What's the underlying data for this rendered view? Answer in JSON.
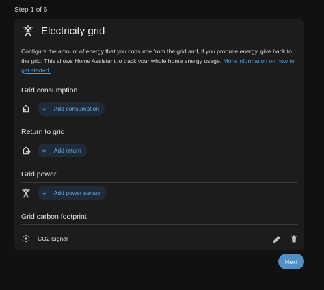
{
  "step_label": "Step 1 of 6",
  "card": {
    "title": "Electricity grid",
    "icon": "transmission-tower-icon",
    "description": "Configure the amount of energy that you consume from the grid and, if you produce energy, give back to the grid. This allows Home Assistant to track your whole home energy usage.",
    "link_text": "More information on how to get started."
  },
  "sections": {
    "consumption": {
      "title": "Grid consumption",
      "button": "Add consumption",
      "icon": "home-import-icon"
    },
    "return": {
      "title": "Return to grid",
      "button": "Add return",
      "icon": "home-export-icon"
    },
    "power": {
      "title": "Grid power",
      "button": "Add power sensor",
      "icon": "transmission-tower-icon"
    },
    "carbon": {
      "title": "Grid carbon footprint",
      "item": "CO2 Signal",
      "icon": "co2-icon"
    }
  },
  "next_label": "Next",
  "colors": {
    "accent": "#4f8fc4",
    "link": "#4a9fe0",
    "card": "#1c1c1c",
    "background": "#111111"
  }
}
